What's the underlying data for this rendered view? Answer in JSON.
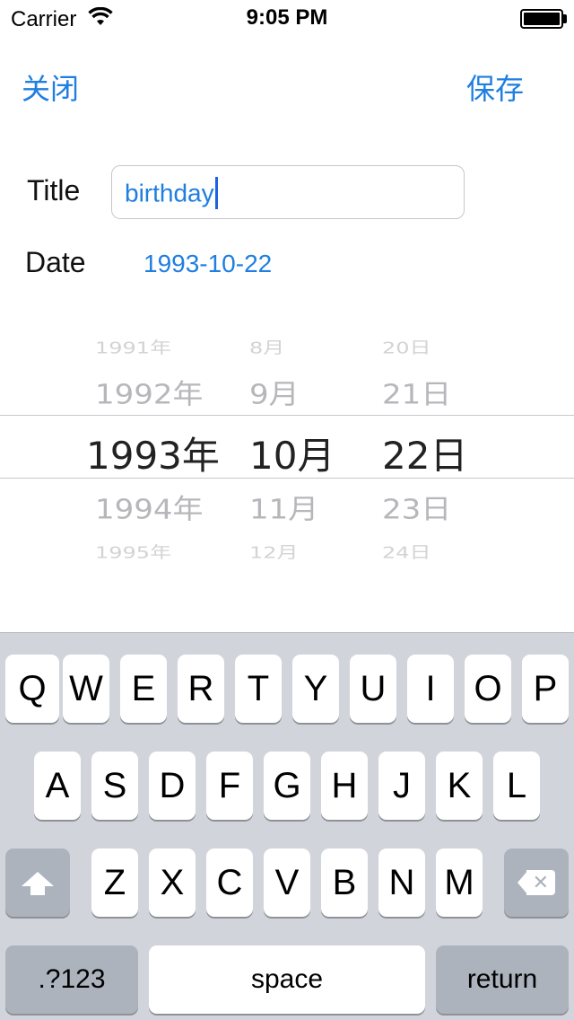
{
  "status_bar": {
    "carrier": "Carrier",
    "time": "9:05 PM"
  },
  "nav": {
    "close_label": "关闭",
    "save_label": "保存"
  },
  "form": {
    "title_label": "Title",
    "title_value": "birthday",
    "date_label": "Date",
    "date_value": "1993-10-22"
  },
  "picker": {
    "years": [
      "1991年",
      "1992年",
      "1993年",
      "1994年",
      "1995年"
    ],
    "months": [
      "8月",
      "9月",
      "10月",
      "11月",
      "12月"
    ],
    "days": [
      "20日",
      "21日",
      "22日",
      "23日",
      "24日"
    ]
  },
  "keyboard": {
    "row1": [
      "Q",
      "W",
      "E",
      "R",
      "T",
      "Y",
      "U",
      "I",
      "O",
      "P"
    ],
    "row2": [
      "A",
      "S",
      "D",
      "F",
      "G",
      "H",
      "J",
      "K",
      "L"
    ],
    "row3": [
      "Z",
      "X",
      "C",
      "V",
      "B",
      "N",
      "M"
    ],
    "numbers_label": ".?123",
    "space_label": "space",
    "return_label": "return"
  },
  "icons": {
    "wifi": "wifi-icon",
    "battery": "battery-icon",
    "shift": "shift-icon",
    "delete": "delete-icon"
  }
}
